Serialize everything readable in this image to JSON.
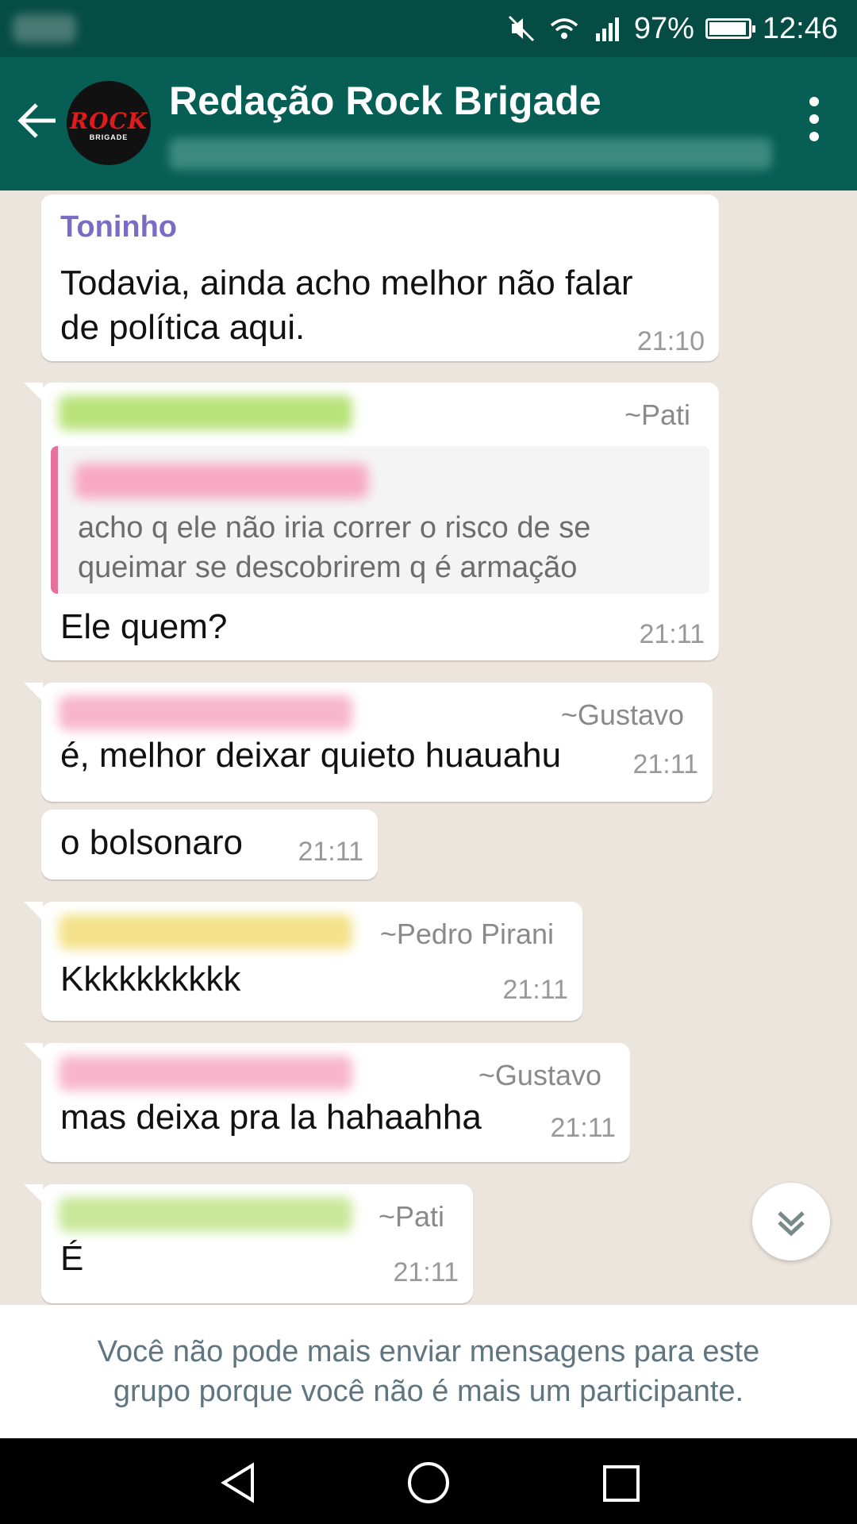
{
  "status_bar": {
    "battery": "97%",
    "time": "12:46",
    "icons": [
      "mute-icon",
      "wifi-icon",
      "signal-icon",
      "battery-icon"
    ]
  },
  "header": {
    "title": "Redação Rock Brigade",
    "avatar_logo_text": "ROCK",
    "avatar_logo_sub": "BRIGADE"
  },
  "messages": [
    {
      "sender": "Toninho",
      "text_line1": "Todavia, ainda acho melhor não falar",
      "text_line2": "de política aqui.",
      "time": "21:10"
    },
    {
      "author": "~Pati",
      "quote_line1": "acho q ele não iria correr o risco de se",
      "quote_line2": "queimar se descobrirem q é armação",
      "text": "Ele quem?",
      "time": "21:11"
    },
    {
      "author": "~Gustavo",
      "text": "é, melhor deixar quieto huauahu",
      "time": "21:11"
    },
    {
      "text": "o bolsonaro",
      "time": "21:11"
    },
    {
      "author": "~Pedro Pirani",
      "text": "Kkkkkkkkkk",
      "time": "21:11"
    },
    {
      "author": "~Gustavo",
      "text": "mas deixa pra la hahaahha",
      "time": "21:11"
    },
    {
      "author": "~Pati",
      "text": "É",
      "time": "21:11"
    }
  ],
  "notice": {
    "line1": "Você não pode mais enviar mensagens para este",
    "line2": "grupo porque você não é mais um participante."
  },
  "colors": {
    "header": "#075e54",
    "status_bar": "#054c44",
    "chat_bg": "#ece5dd",
    "sender_name": "#7b6cc3",
    "quote_bar": "#e4729a"
  }
}
